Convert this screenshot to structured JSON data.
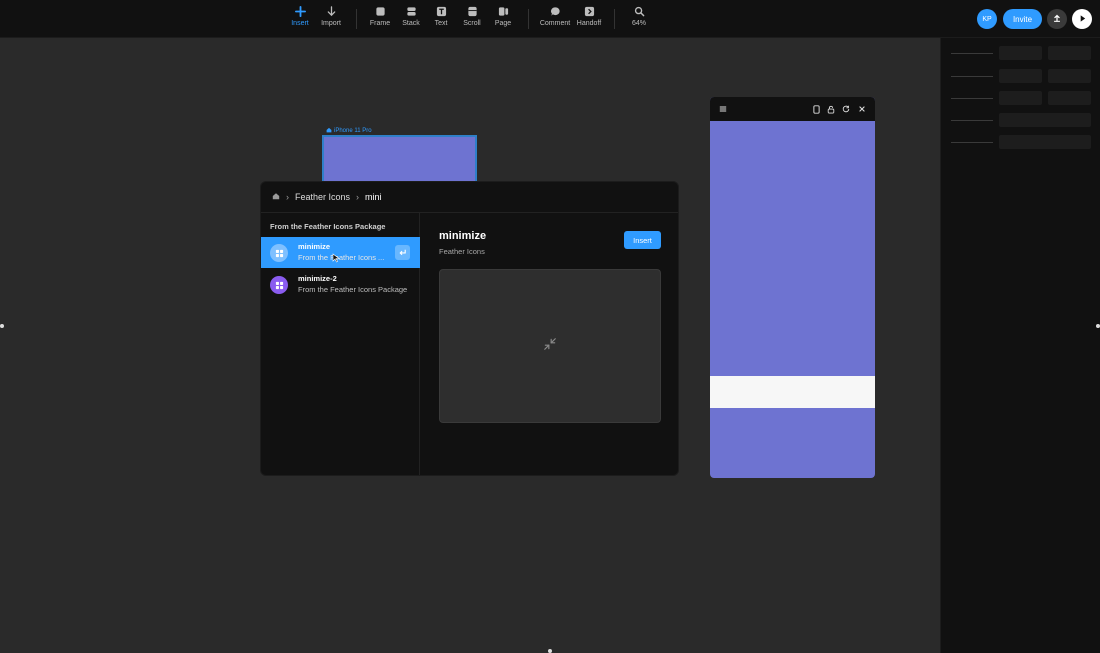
{
  "toolbar": {
    "tools": [
      {
        "label": "Insert",
        "icon": "plus-icon"
      },
      {
        "label": "Import",
        "icon": "download-arrow-icon"
      },
      {
        "label": "Frame",
        "icon": "frame-icon"
      },
      {
        "label": "Stack",
        "icon": "stack-icon"
      },
      {
        "label": "Text",
        "icon": "text-icon"
      },
      {
        "label": "Scroll",
        "icon": "scroll-icon"
      },
      {
        "label": "Page",
        "icon": "page-icon"
      },
      {
        "label": "Comment",
        "icon": "comment-icon"
      },
      {
        "label": "Handoff",
        "icon": "handoff-icon"
      },
      {
        "label": "64%",
        "icon": "zoom-icon"
      }
    ],
    "avatar_initials": "KP",
    "invite_label": "Invite",
    "accent": "#2f9bff"
  },
  "canvas": {
    "frame_label": "iPhone 11 Pro",
    "frame_color": "#6e73d1"
  },
  "modal": {
    "breadcrumb": [
      "Feather Icons",
      "mini"
    ],
    "section_title": "From the Feather Icons Package",
    "items": [
      {
        "name": "minimize",
        "subtitle": "From the Feather Icons ...",
        "selected": true,
        "badge_color": "#7fc0ff"
      },
      {
        "name": "minimize-2",
        "subtitle": "From the Feather Icons Package",
        "selected": false,
        "badge_color": "#8a5cf0"
      }
    ],
    "preview": {
      "title": "minimize",
      "subtitle": "Feather Icons",
      "insert_label": "Insert",
      "icon": "minimize-icon"
    }
  }
}
